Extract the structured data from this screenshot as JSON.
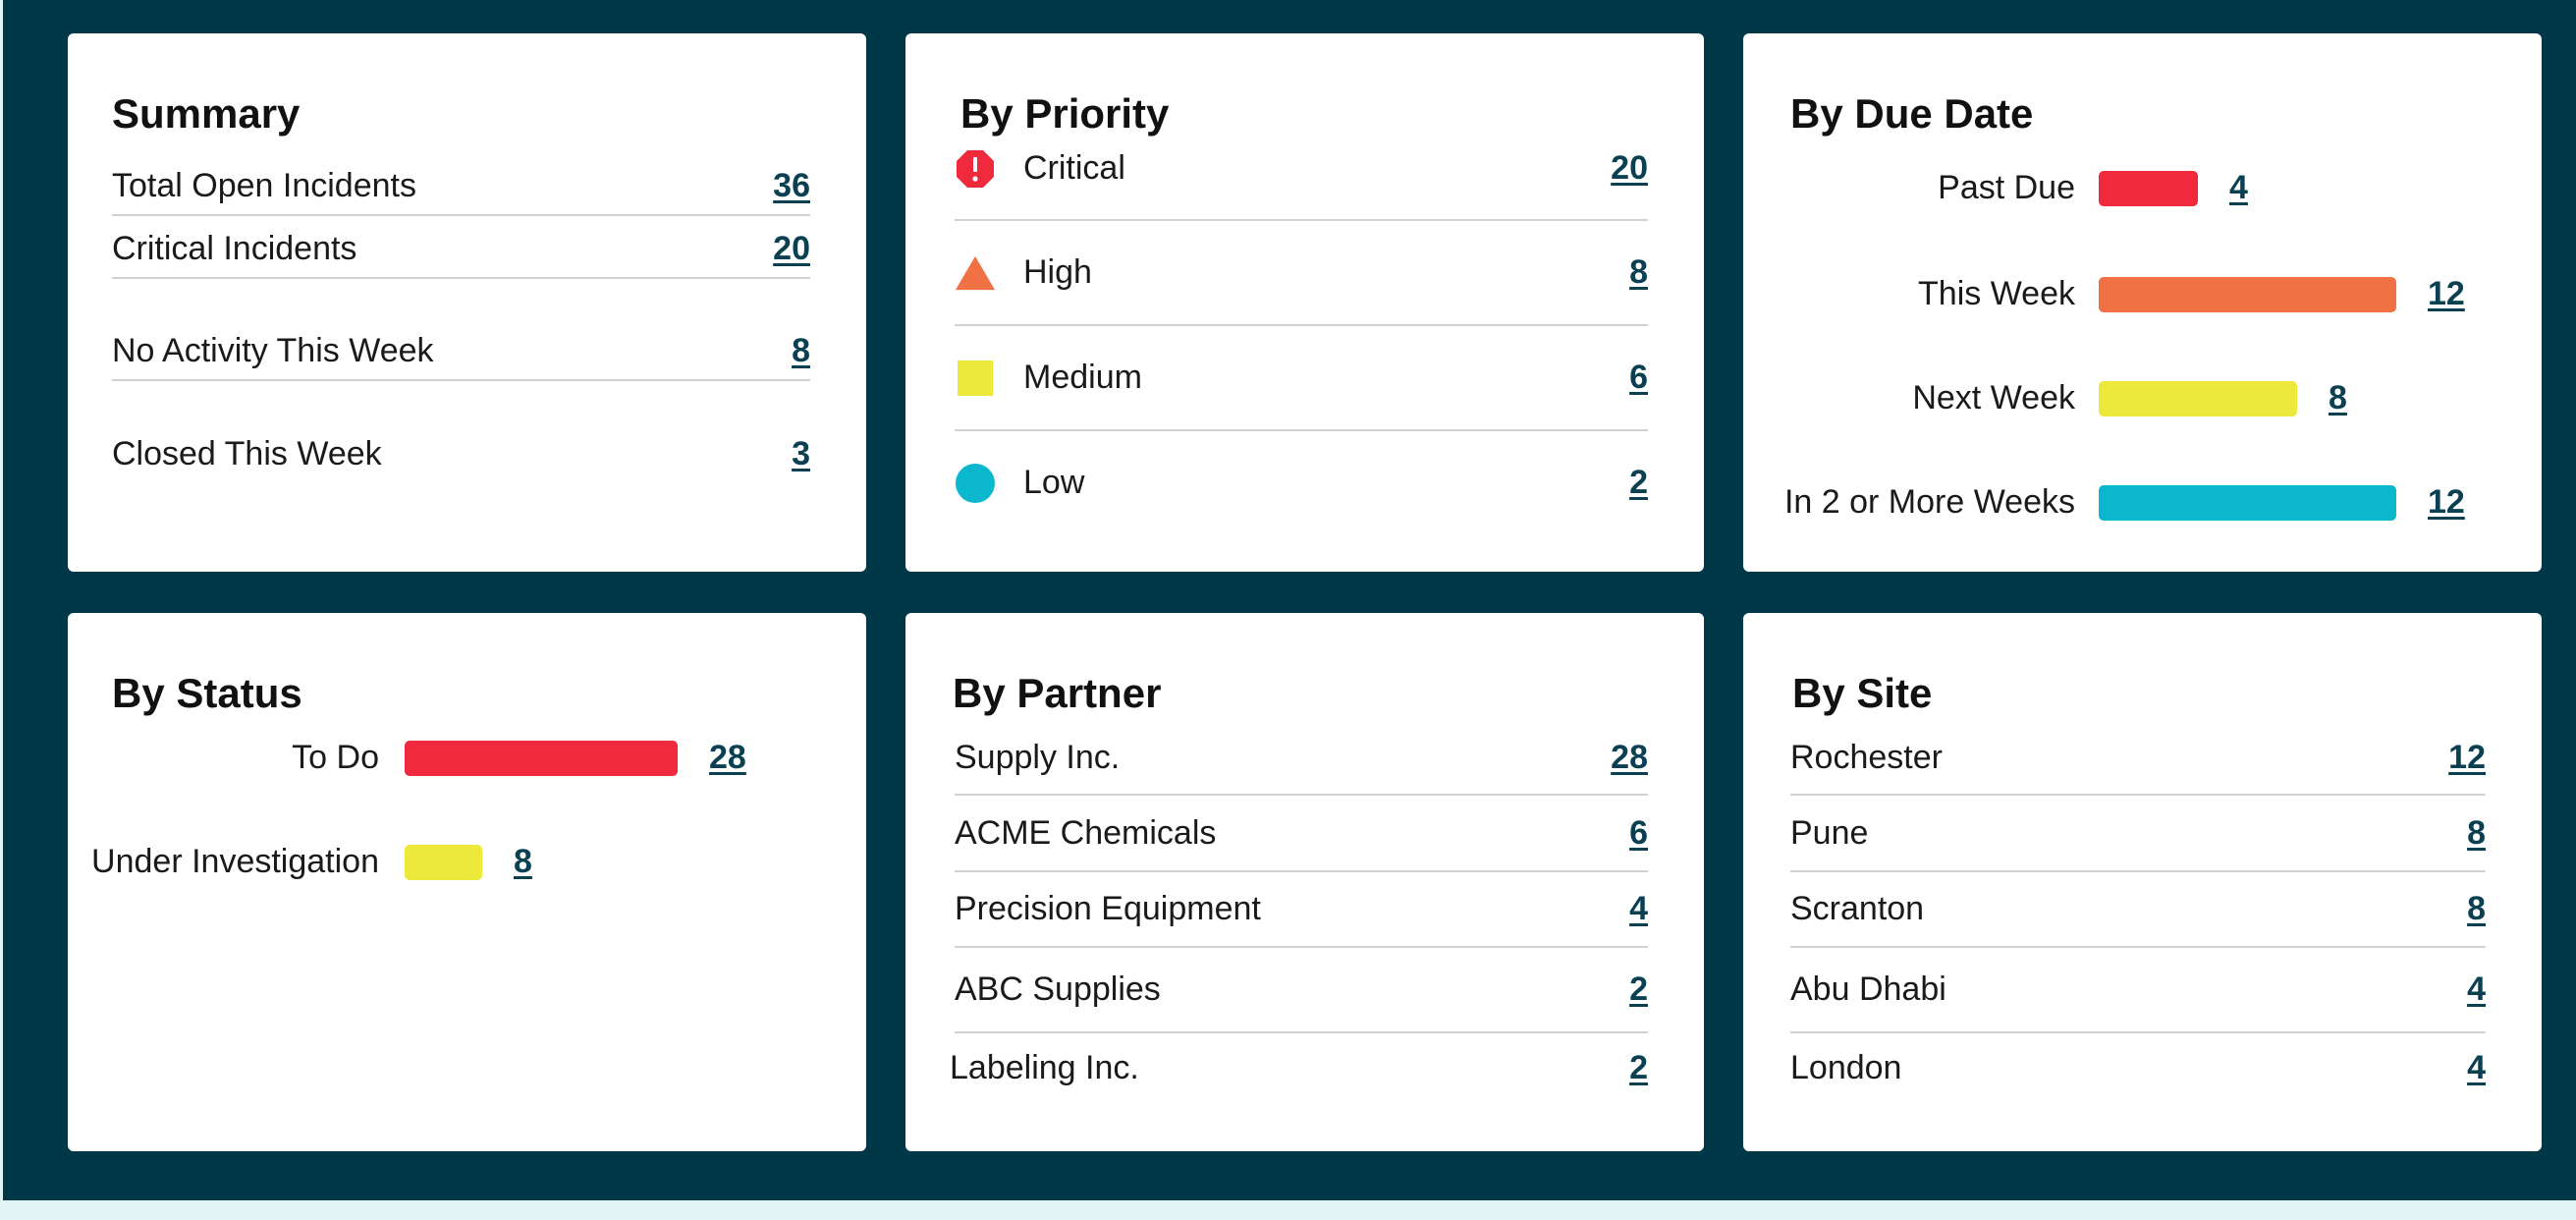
{
  "colors": {
    "background": "#003847",
    "footer": "#e2f4f4",
    "critical": "#ee2a3c",
    "high": "#f07244",
    "medium": "#ede93a",
    "low": "#0bb7cc",
    "link": "#0a4051"
  },
  "summary": {
    "title": "Summary",
    "rows": [
      {
        "label": "Total Open Incidents",
        "value": "36"
      },
      {
        "label": "Critical Incidents",
        "value": "20"
      },
      {
        "label": "No Activity This Week",
        "value": "8"
      },
      {
        "label": "Closed This Week",
        "value": "3"
      }
    ]
  },
  "priority": {
    "title": "By Priority",
    "rows": [
      {
        "label": "Critical",
        "value": "20",
        "icon": "critical-octagon-icon"
      },
      {
        "label": "High",
        "value": "8",
        "icon": "high-triangle-icon"
      },
      {
        "label": "Medium",
        "value": "6",
        "icon": "medium-square-icon"
      },
      {
        "label": "Low",
        "value": "2",
        "icon": "low-circle-icon"
      }
    ]
  },
  "due_date": {
    "title": "By Due Date",
    "max": 12,
    "rows": [
      {
        "label": "Past Due",
        "value": 4,
        "color": "#ee2a3c"
      },
      {
        "label": "This Week",
        "value": 12,
        "color": "#f07244"
      },
      {
        "label": "Next Week",
        "value": 8,
        "color": "#ede93a"
      },
      {
        "label": "In 2 or More Weeks",
        "value": 12,
        "color": "#0bb7cc"
      }
    ]
  },
  "status": {
    "title": "By Status",
    "max": 28,
    "rows": [
      {
        "label": "To Do",
        "value": 28,
        "color": "#ee2a3c"
      },
      {
        "label": "Under Investigation",
        "value": 8,
        "color": "#ede93a"
      }
    ]
  },
  "partner": {
    "title": "By Partner",
    "rows": [
      {
        "label": "Supply Inc.",
        "value": "28"
      },
      {
        "label": "ACME Chemicals",
        "value": "6"
      },
      {
        "label": "Precision Equipment",
        "value": "4"
      },
      {
        "label": "ABC Supplies",
        "value": "2"
      },
      {
        "label": "Labeling Inc.",
        "value": "2"
      }
    ]
  },
  "site": {
    "title": "By Site",
    "rows": [
      {
        "label": "Rochester",
        "value": "12"
      },
      {
        "label": "Pune",
        "value": "8"
      },
      {
        "label": "Scranton",
        "value": "8"
      },
      {
        "label": "Abu Dhabi",
        "value": "4"
      },
      {
        "label": "London",
        "value": "4"
      }
    ]
  }
}
